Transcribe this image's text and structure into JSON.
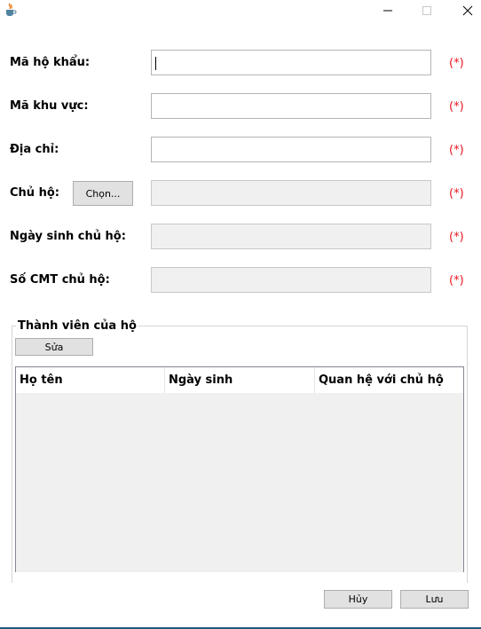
{
  "window": {
    "app_icon": "java-cup-icon",
    "controls": [
      "minimize-icon",
      "maximize-icon",
      "close-icon"
    ]
  },
  "form": {
    "ma_ho_khau": {
      "label": "Mã hộ khẩu:",
      "value": "",
      "required": "(*)"
    },
    "ma_khu_vuc": {
      "label": "Mã khu vực:",
      "value": "",
      "required": "(*)"
    },
    "dia_chi": {
      "label": "Địa chỉ:",
      "value": "",
      "required": "(*)"
    },
    "chu_ho": {
      "label": "Chủ hộ:",
      "button": "Chọn...",
      "value": "",
      "required": "(*)"
    },
    "ngay_sinh_chu_ho": {
      "label": "Ngày sinh chủ hộ:",
      "value": "",
      "required": "(*)"
    },
    "so_cmt_chu_ho": {
      "label": "Số CMT chủ hộ:",
      "value": "",
      "required": "(*)"
    }
  },
  "members": {
    "title": "Thành viên của hộ",
    "edit_button": "Sửa",
    "columns": [
      "Họ tên",
      "Ngày sinh",
      "Quan hệ với chủ hộ"
    ],
    "rows": []
  },
  "actions": {
    "cancel": "Hủy",
    "save": "Lưu"
  },
  "colors": {
    "required": "#e8151e",
    "button_bg": "#e1e1e1",
    "disabled_field": "#f0f0f0"
  }
}
